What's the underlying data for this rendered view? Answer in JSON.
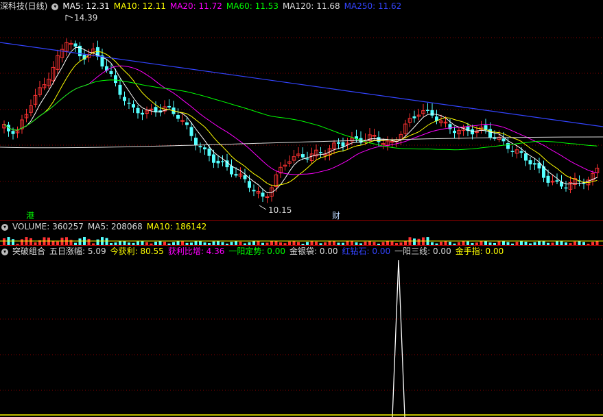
{
  "price_panel": {
    "title": "深科技(日线)",
    "ma_labels": [
      {
        "label": "MA5: 12.31",
        "color": "#ffffff"
      },
      {
        "label": "MA10: 12.11",
        "color": "#ffff00"
      },
      {
        "label": "MA20: 11.72",
        "color": "#ff00ff"
      },
      {
        "label": "MA60: 11.53",
        "color": "#00ff00"
      },
      {
        "label": "MA120: 11.68",
        "color": "#dddddd"
      },
      {
        "label": "MA250: 11.62",
        "color": "#3344ff"
      }
    ],
    "high_label": "14.39",
    "low_label": "10.15",
    "marker_gang": "港",
    "marker_cai": "财"
  },
  "volume_panel": {
    "labels": [
      {
        "label": "VOLUME: 360257",
        "color": "#dddddd"
      },
      {
        "label": "MA5: 208068",
        "color": "#dddddd"
      },
      {
        "label": "MA10: 186142",
        "color": "#ffff00"
      }
    ]
  },
  "indicator_panel": {
    "labels": [
      {
        "label": "突破组合",
        "color": "#dddddd"
      },
      {
        "label": "五日涨幅: 5.09",
        "color": "#dddddd"
      },
      {
        "label": "今获利: 80.55",
        "color": "#ffff00"
      },
      {
        "label": "获利比增: 4.36",
        "color": "#ff00ff"
      },
      {
        "label": "一阳定势: 0.00",
        "color": "#00ff00"
      },
      {
        "label": "金银袋: 0.00",
        "color": "#dddddd"
      },
      {
        "label": "红钻石: 0.00",
        "color": "#3344ff"
      },
      {
        "label": "一阳三线: 0.00",
        "color": "#dddddd"
      },
      {
        "label": "金手指: 0.00",
        "color": "#ffff00"
      }
    ]
  },
  "colors": {
    "up": "#ff3232",
    "down": "#54ffff",
    "grid": "#8b0000"
  }
}
